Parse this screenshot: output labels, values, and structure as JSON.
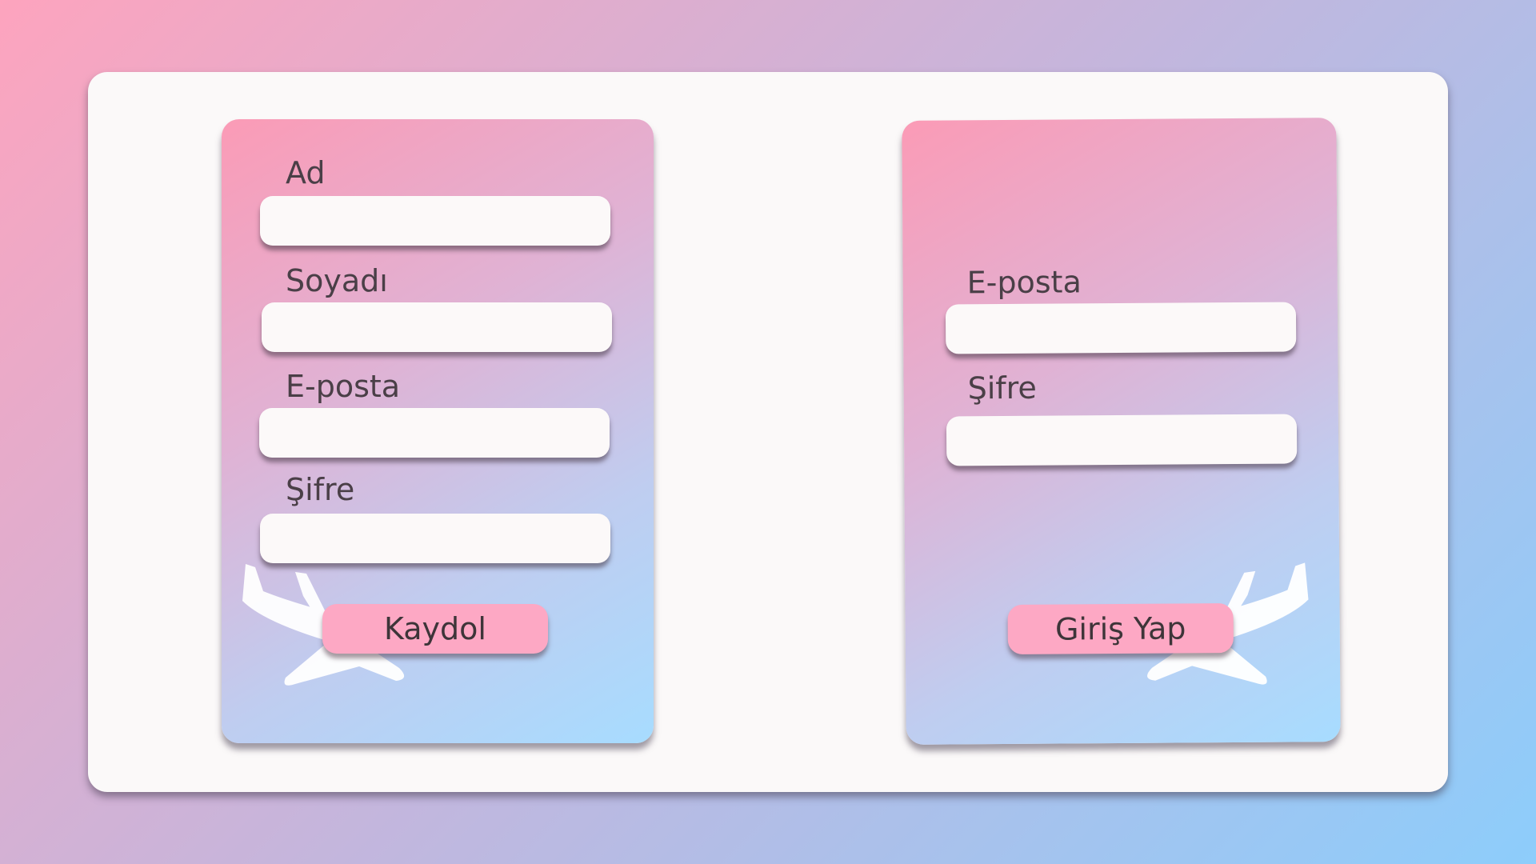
{
  "register_form": {
    "fields": [
      {
        "label": "Ad",
        "value": "",
        "placeholder": ""
      },
      {
        "label": "Soyadı",
        "value": "",
        "placeholder": ""
      },
      {
        "label": "E-posta",
        "value": "",
        "placeholder": ""
      },
      {
        "label": "Şifre",
        "value": "",
        "placeholder": ""
      }
    ],
    "submit_label": "Kaydol",
    "decoration_icon": "airplane-icon"
  },
  "login_form": {
    "fields": [
      {
        "label": "E-posta",
        "value": "",
        "placeholder": ""
      },
      {
        "label": "Şifre",
        "value": "",
        "placeholder": ""
      }
    ],
    "submit_label": "Giriş Yap",
    "decoration_icon": "airplane-icon"
  },
  "colors": {
    "background_start": "#fda4be",
    "background_end": "#8dcdfb",
    "panel": "#fbf9f9",
    "card_gradient_start": "#fb9bb6",
    "card_gradient_end": "#a7dcff",
    "button": "#fda8c4",
    "input": "#fcf9f9",
    "text": "#4a3f47"
  }
}
